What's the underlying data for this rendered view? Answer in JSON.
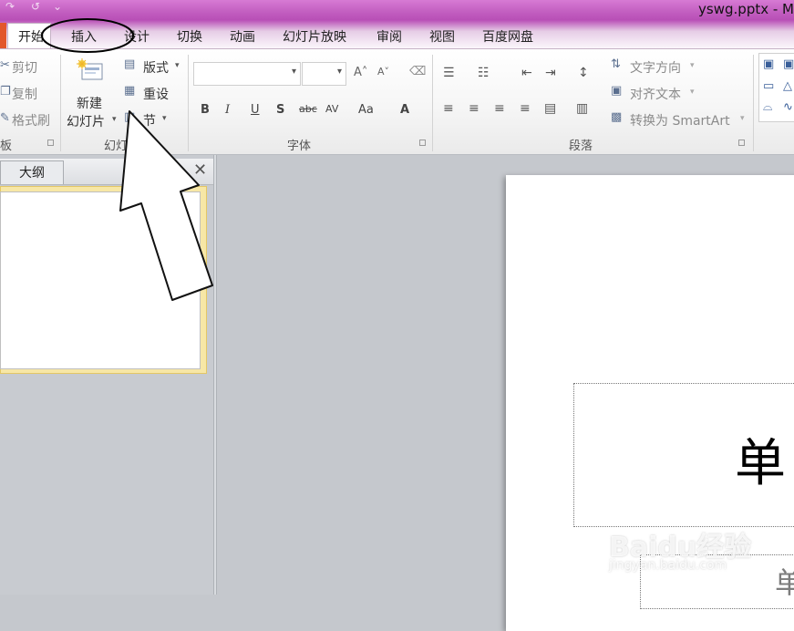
{
  "window": {
    "title": "yswg.pptx - M"
  },
  "tabs": [
    {
      "label": "开始",
      "selected": true
    },
    {
      "label": "插入",
      "highlighted": true
    },
    {
      "label": "设计"
    },
    {
      "label": "切换"
    },
    {
      "label": "动画"
    },
    {
      "label": "幻灯片放映"
    },
    {
      "label": "审阅"
    },
    {
      "label": "视图"
    },
    {
      "label": "百度网盘"
    }
  ],
  "clipboard": {
    "cut": "剪切",
    "copy": "复制",
    "format_painter": "格式刷",
    "group_label": "板"
  },
  "slides_group": {
    "new_slide_line1": "新建",
    "new_slide_line2": "幻灯片",
    "layout": "版式",
    "reset": "重设",
    "section": "节",
    "group_label": "幻灯片"
  },
  "font_group": {
    "group_label": "字体",
    "bold": "B",
    "italic": "I",
    "underline": "U",
    "shadow": "S",
    "strikethrough": "abc",
    "char_spacing": "AV",
    "change_case": "Aa",
    "font_color": "A"
  },
  "paragraph_group": {
    "text_direction": "文字方向",
    "align_text": "对齐文本",
    "convert_smartart": "转换为 SmartArt",
    "group_label": "段落"
  },
  "panel": {
    "outline_tab": "大纲",
    "close": "✕"
  },
  "slide": {
    "title_text": "单",
    "subtitle_text": "单"
  },
  "watermark": {
    "main": "Baidu经验",
    "sub": "jingyan.baidu.com"
  },
  "colors": {
    "titlebar": "#c25ec0",
    "file_tab": "#e2572b",
    "thumb_border": "#f7e7a6",
    "annotation": "#000000"
  }
}
